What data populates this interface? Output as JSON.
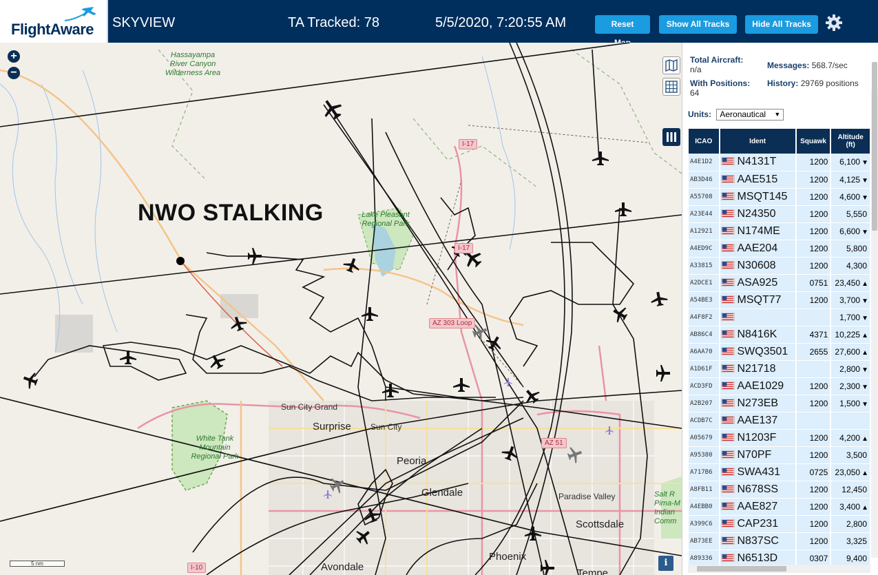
{
  "header": {
    "logo_text": "FlightAware",
    "app_title": "SKYVIEW",
    "ta_tracked": "TA Tracked: 78",
    "clock": "5/5/2020, 7:20:55 AM",
    "reset_map": "Reset Map",
    "show_all_tracks": "Show All Tracks",
    "hide_all_tracks": "Hide All Tracks"
  },
  "map": {
    "overlay_text": "NWO STALKING",
    "scale_label": "5 nm",
    "labels": {
      "hassayampa": "Hassayampa River Canyon Wilderness Area",
      "lake_pleasant": "Lake Pleasant Regional Park",
      "white_tank": "White Tank Mountain Regional Park",
      "sun_city_grand": "Sun City Grand",
      "surprise": "Surprise",
      "sun_city": "Sun City",
      "peoria": "Peoria",
      "glendale": "Glendale",
      "paradise_valley": "Paradise Valley",
      "scottsdale": "Scottsdale",
      "phoenix": "Phoenix",
      "avondale": "Avondale",
      "tempe": "Tempe",
      "salt_river": "Salt R Pima-M Indian Comm"
    },
    "shields": {
      "i17_a": "I-17",
      "i17_b": "I-17",
      "az303": "AZ 303 Loop",
      "az51": "AZ 51",
      "i10": "I-10"
    }
  },
  "panel": {
    "total_aircraft_label": "Total Aircraft:",
    "total_aircraft_value": "n/a",
    "with_positions_label": "With Positions:",
    "with_positions_value": "64",
    "messages_label": "Messages:",
    "messages_value": "568.7/sec",
    "history_label": "History:",
    "history_value": "29769 positions",
    "units_label": "Units:",
    "units_value": "Aeronautical",
    "columns": [
      "ICAO",
      "Ident",
      "Squawk",
      "Altitude (ft)"
    ],
    "rows": [
      {
        "icao": "A4E1D2",
        "ident": "N4131T",
        "squawk": "1200",
        "alt": "6,100",
        "trend": "▼"
      },
      {
        "icao": "AB3D46",
        "ident": "AAE515",
        "squawk": "1200",
        "alt": "4,125",
        "trend": "▼"
      },
      {
        "icao": "A55708",
        "ident": "MSQT145",
        "squawk": "1200",
        "alt": "4,600",
        "trend": "▼"
      },
      {
        "icao": "A23E44",
        "ident": "N24350",
        "squawk": "1200",
        "alt": "5,550",
        "trend": ""
      },
      {
        "icao": "A12921",
        "ident": "N174ME",
        "squawk": "1200",
        "alt": "6,600",
        "trend": "▼"
      },
      {
        "icao": "A4ED9C",
        "ident": "AAE204",
        "squawk": "1200",
        "alt": "5,800",
        "trend": ""
      },
      {
        "icao": "A33815",
        "ident": "N30608",
        "squawk": "1200",
        "alt": "4,300",
        "trend": ""
      },
      {
        "icao": "A2DCE1",
        "ident": "ASA925",
        "squawk": "0751",
        "alt": "23,450",
        "trend": "▲"
      },
      {
        "icao": "A54BE3",
        "ident": "MSQT77",
        "squawk": "1200",
        "alt": "3,700",
        "trend": "▼"
      },
      {
        "icao": "A4F8F2",
        "ident": "",
        "squawk": "",
        "alt": "1,700",
        "trend": "▼"
      },
      {
        "icao": "AB86C4",
        "ident": "N8416K",
        "squawk": "4371",
        "alt": "10,225",
        "trend": "▲"
      },
      {
        "icao": "A6AA70",
        "ident": "SWQ3501",
        "squawk": "2655",
        "alt": "27,600",
        "trend": "▲"
      },
      {
        "icao": "A1D61F",
        "ident": "N21718",
        "squawk": "",
        "alt": "2,800",
        "trend": "▼"
      },
      {
        "icao": "ACD3FD",
        "ident": "AAE1029",
        "squawk": "1200",
        "alt": "2,300",
        "trend": "▼"
      },
      {
        "icao": "A2B207",
        "ident": "N273EB",
        "squawk": "1200",
        "alt": "1,500",
        "trend": "▼"
      },
      {
        "icao": "ACDB7C",
        "ident": "AAE137",
        "squawk": "",
        "alt": "",
        "trend": ""
      },
      {
        "icao": "A05679",
        "ident": "N1203F",
        "squawk": "1200",
        "alt": "4,200",
        "trend": "▲"
      },
      {
        "icao": "A95380",
        "ident": "N70PF",
        "squawk": "1200",
        "alt": "3,500",
        "trend": ""
      },
      {
        "icao": "A717B6",
        "ident": "SWA431",
        "squawk": "0725",
        "alt": "23,050",
        "trend": "▲"
      },
      {
        "icao": "A8FB11",
        "ident": "N678SS",
        "squawk": "1200",
        "alt": "12,450",
        "trend": ""
      },
      {
        "icao": "A4EBB0",
        "ident": "AAE827",
        "squawk": "1200",
        "alt": "3,400",
        "trend": "▲"
      },
      {
        "icao": "A399C6",
        "ident": "CAP231",
        "squawk": "1200",
        "alt": "2,800",
        "trend": ""
      },
      {
        "icao": "AB73EE",
        "ident": "N837SC",
        "squawk": "1200",
        "alt": "3,325",
        "trend": ""
      },
      {
        "icao": "A89336",
        "ident": "N6513D",
        "squawk": "0307",
        "alt": "9,400",
        "trend": ""
      }
    ]
  },
  "colors": {
    "header_bg": "#002f5d",
    "button_bg": "#1b9be0",
    "table_header_bg": "#0b2e54",
    "row_bg": "#ddeefc"
  }
}
